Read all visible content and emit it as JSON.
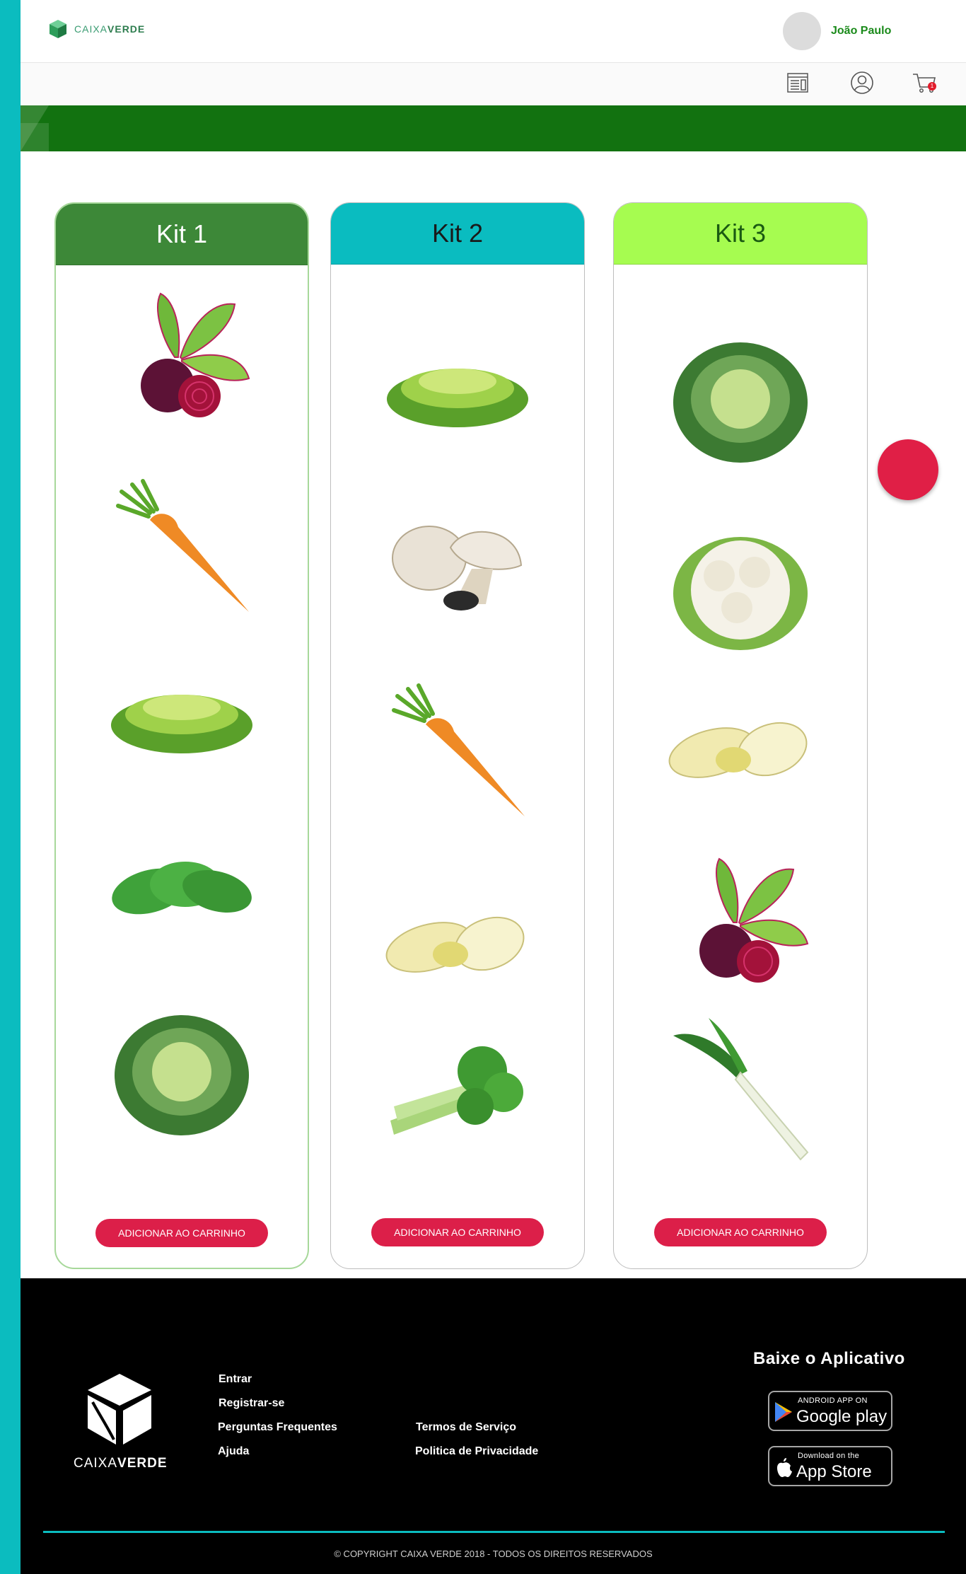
{
  "header": {
    "logo_text_light": "CAIXA",
    "logo_text_bold": "VERDE",
    "user_name": "João Paulo",
    "cart_count": "1"
  },
  "icons": {
    "news": "newspaper-icon",
    "profile": "user-circle-icon",
    "cart": "cart-icon"
  },
  "colors": {
    "brand_green": "#127210",
    "accent_teal": "#0bbcbf",
    "button_red": "#dc1f49",
    "kit1_header": "#3d8838",
    "kit2_header": "#0abcc0",
    "kit3_header": "#a6fc50"
  },
  "kits": [
    {
      "title": "Kit 1",
      "items": [
        "beet",
        "carrot",
        "lettuce",
        "spinach",
        "cabbage"
      ],
      "button_label": "ADICIONAR AO CARRINHO"
    },
    {
      "title": "Kit 2",
      "items": [
        "lettuce",
        "mushroom",
        "carrot",
        "endive",
        "celery"
      ],
      "button_label": "ADICIONAR AO CARRINHO"
    },
    {
      "title": "Kit 3",
      "items": [
        "cabbage",
        "cauliflower",
        "endive",
        "beet",
        "leek"
      ],
      "button_label": "ADICIONAR AO CARRINHO"
    }
  ],
  "footer": {
    "logo_text_light": "CAIXA",
    "logo_text_bold": "VERDE",
    "links_col1": [
      "Entrar",
      "Registrar-se",
      "Perguntas Frequentes",
      "Ajuda"
    ],
    "links_col2": [
      "Termos de Serviço",
      "Politica de Privacidade"
    ],
    "app_title": "Baixe o Aplicativo",
    "google_small": "ANDROID APP ON",
    "google_big": "Google play",
    "apple_small": "Download on the",
    "apple_big": "App Store",
    "copyright": "© COPYRIGHT CAIXA VERDE 2018 - TODOS OS DIREITOS RESERVADOS"
  }
}
